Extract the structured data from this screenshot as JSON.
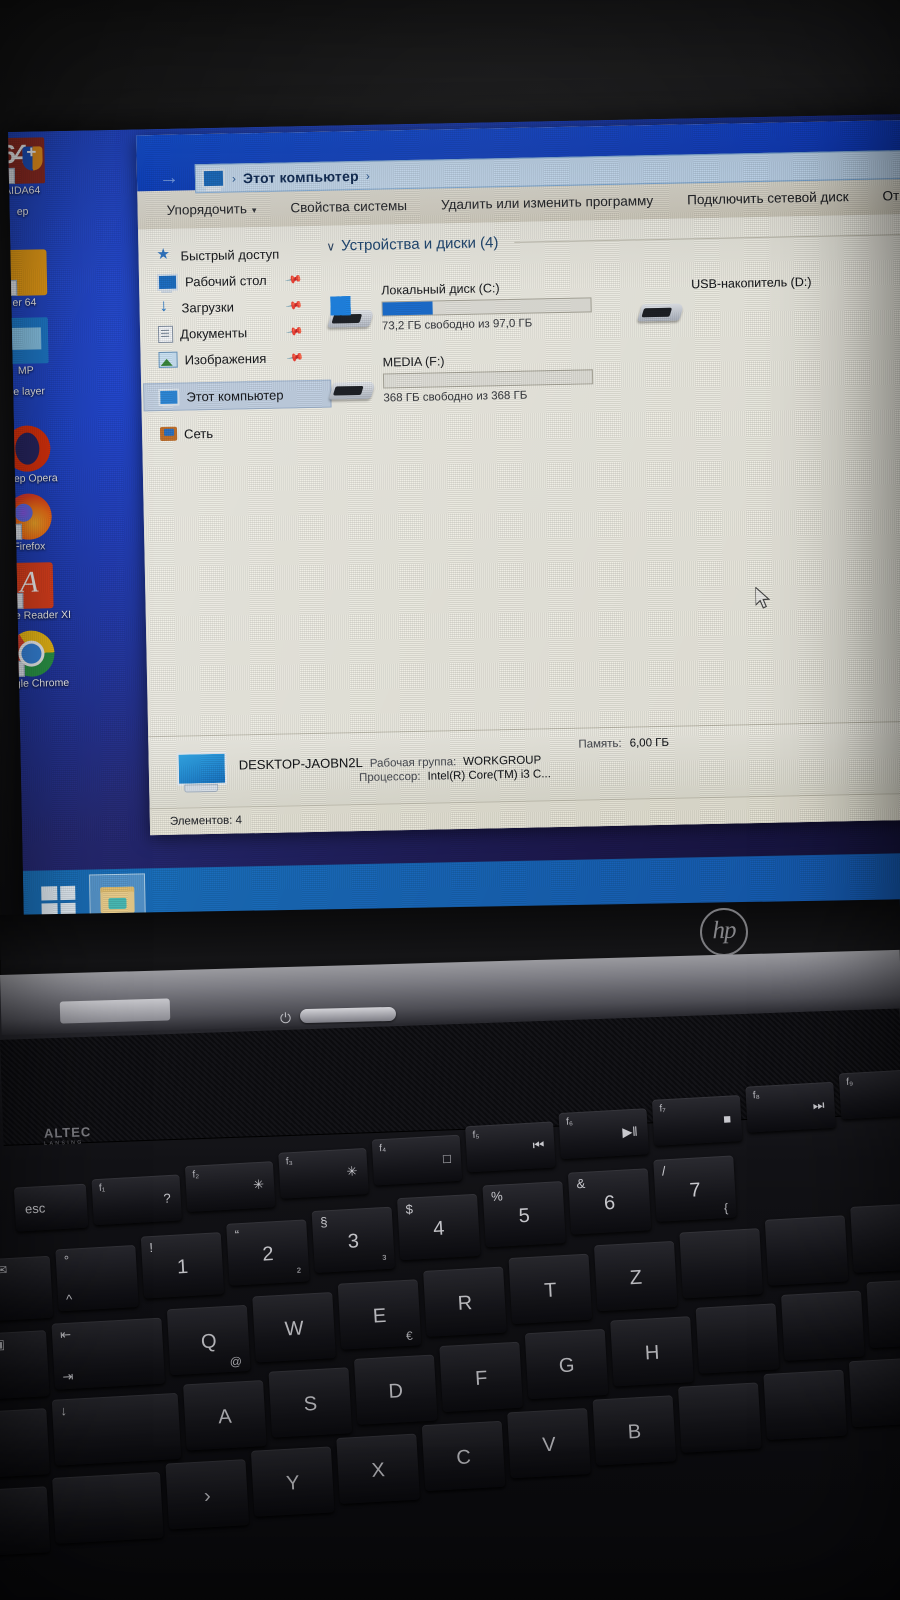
{
  "desktop": {
    "icons": [
      {
        "name": "AIDA64",
        "label": "AIDA64",
        "kind": "aida"
      },
      {
        "name": "cut-off-ep",
        "label": "ер",
        "kind": "cut"
      },
      {
        "name": "cut-off-er-64",
        "label": "er 64",
        "kind": "orange"
      },
      {
        "name": "cut-off-mp",
        "label": "МР",
        "kind": "blue"
      },
      {
        "name": "cut-off-player",
        "label": "ne layer",
        "kind": "cut"
      },
      {
        "name": "opera-browser",
        "label": "аузер Opera",
        "kind": "opera"
      },
      {
        "name": "firefox",
        "label": "Firefox",
        "kind": "firefox"
      },
      {
        "name": "adobe-reader",
        "label": "Adobe Reader XI",
        "kind": "adobe"
      },
      {
        "name": "google-chrome",
        "label": "Google Chrome",
        "kind": "chrome"
      }
    ]
  },
  "explorer": {
    "address": {
      "icon": "this-pc-icon",
      "separator_1": "›",
      "text": "Этот компьютер",
      "separator_2": "›"
    },
    "nav_buttons": {
      "back": "←",
      "forward": "→",
      "up": "↑"
    },
    "toolbar": {
      "organize": "Упорядочить",
      "caret": "▾",
      "items": [
        "Свойства системы",
        "Удалить или изменить программу",
        "Подключить сетевой диск",
        "Открыт"
      ]
    },
    "navigation_pane": {
      "items": [
        {
          "label": "Быстрый доступ",
          "icon": "star-icon",
          "pinned": false,
          "selected": false
        },
        {
          "label": "Рабочий стол",
          "icon": "desktop-icon",
          "pinned": true,
          "selected": false
        },
        {
          "label": "Загрузки",
          "icon": "downloads-icon",
          "pinned": true,
          "selected": false
        },
        {
          "label": "Документы",
          "icon": "documents-icon",
          "pinned": true,
          "selected": false
        },
        {
          "label": "Изображения",
          "icon": "pictures-icon",
          "pinned": true,
          "selected": false
        },
        {
          "label": "Этот компьютер",
          "icon": "this-pc-icon",
          "pinned": false,
          "selected": true
        },
        {
          "label": "Сеть",
          "icon": "network-icon",
          "pinned": false,
          "selected": false
        }
      ],
      "pin_glyph": "📌"
    },
    "content": {
      "group_title": "Устройства и диски (4)",
      "chevron": "∨",
      "drives": [
        {
          "name": "Локальный диск (C:)",
          "free_text": "73,2 ГБ свободно из 97,0 ГБ",
          "used_percent": 24,
          "bar_color": "#1677d6",
          "icon": "system-drive-icon",
          "show_bar": true
        },
        {
          "name": "USB-накопитель (D:)",
          "free_text": "",
          "used_percent": 0,
          "bar_color": "#1677d6",
          "icon": "usb-drive-icon",
          "show_bar": false
        },
        {
          "name": "MEDIA (F:)",
          "free_text": "368 ГБ свободно из 368 ГБ",
          "used_percent": 0,
          "bar_color": "#1677d6",
          "icon": "usb-drive-icon",
          "show_bar": true
        },
        {
          "name": "",
          "free_text": "",
          "used_percent": 0,
          "bar_color": "#1677d6",
          "icon": "usb-drive-icon",
          "show_bar": false
        }
      ]
    },
    "details_pane": {
      "computer_name": "DESKTOP-JAOBN2L",
      "workgroup_label": "Рабочая группа:",
      "workgroup_value": "WORKGROUP",
      "processor_label": "Процессор:",
      "processor_value": "Intel(R) Core(TM) i3 C...",
      "memory_label": "Память:",
      "memory_value": "6,00 ГБ"
    },
    "status_bar": {
      "items_text": "Элементов: 4"
    }
  },
  "taskbar": {
    "start_button": "windows-start-icon",
    "tasks": [
      {
        "name": "file-explorer",
        "icon": "folder-icon",
        "active": true
      }
    ]
  },
  "laptop": {
    "brand": "hp",
    "speaker_brand": "ALTEC",
    "speaker_sub": "LANSING",
    "power_icon": "⏻",
    "keyboard": {
      "fn_row": [
        {
          "key": "esc",
          "label": "esc"
        },
        {
          "key": "f1",
          "fn": "f₁",
          "glyph": "?"
        },
        {
          "key": "f2",
          "fn": "f₂",
          "glyph": "✳"
        },
        {
          "key": "f3",
          "fn": "f₃",
          "glyph": "✳"
        },
        {
          "key": "f4",
          "fn": "f₄",
          "glyph": "□"
        },
        {
          "key": "f5",
          "fn": "f₅",
          "glyph": "⏮"
        },
        {
          "key": "f6",
          "fn": "f₆",
          "glyph": "▶‖"
        },
        {
          "key": "f7",
          "fn": "f₇",
          "glyph": "■"
        },
        {
          "key": "f8",
          "fn": "f₈",
          "glyph": "⏭"
        },
        {
          "key": "f9",
          "fn": "f₉",
          "glyph": ""
        }
      ],
      "number_row": [
        {
          "key": "mail",
          "tl": "✉"
        },
        {
          "key": "circ",
          "tl": "°",
          "bl": "^"
        },
        {
          "key": "1",
          "tl": "!",
          "main": "1"
        },
        {
          "key": "2",
          "tl": "“",
          "main": "2",
          "br": "²"
        },
        {
          "key": "3",
          "tl": "§",
          "main": "3",
          "br": "³"
        },
        {
          "key": "4",
          "tl": "$",
          "main": "4"
        },
        {
          "key": "5",
          "tl": "%",
          "main": "5"
        },
        {
          "key": "6",
          "tl": "&",
          "main": "6"
        },
        {
          "key": "7",
          "tl": "/",
          "main": "7",
          "br": "{"
        }
      ],
      "qwertz_row": [
        {
          "key": "print",
          "tl": "▣"
        },
        {
          "key": "tab",
          "tl": "⇤",
          "bl": "⇥"
        },
        {
          "key": "q",
          "main": "Q",
          "br": "@"
        },
        {
          "key": "w",
          "main": "W"
        },
        {
          "key": "e",
          "main": "E",
          "br": "€"
        },
        {
          "key": "r",
          "main": "R"
        },
        {
          "key": "t",
          "main": "T"
        },
        {
          "key": "z",
          "main": "Z"
        }
      ],
      "home_row": [
        {
          "key": "caps",
          "tl": "↓"
        },
        {
          "key": "a",
          "main": "A"
        },
        {
          "key": "s",
          "main": "S"
        },
        {
          "key": "d",
          "main": "D"
        },
        {
          "key": "f",
          "main": "F"
        },
        {
          "key": "g",
          "main": "G"
        },
        {
          "key": "h",
          "main": "H"
        }
      ],
      "bottom_row": [
        {
          "key": "shift",
          "main": ""
        },
        {
          "key": "lt",
          "main": "›"
        },
        {
          "key": "y",
          "main": "Y"
        },
        {
          "key": "x",
          "main": "X"
        },
        {
          "key": "c",
          "main": "C"
        },
        {
          "key": "v",
          "main": "V"
        },
        {
          "key": "b",
          "main": "B"
        }
      ]
    }
  }
}
